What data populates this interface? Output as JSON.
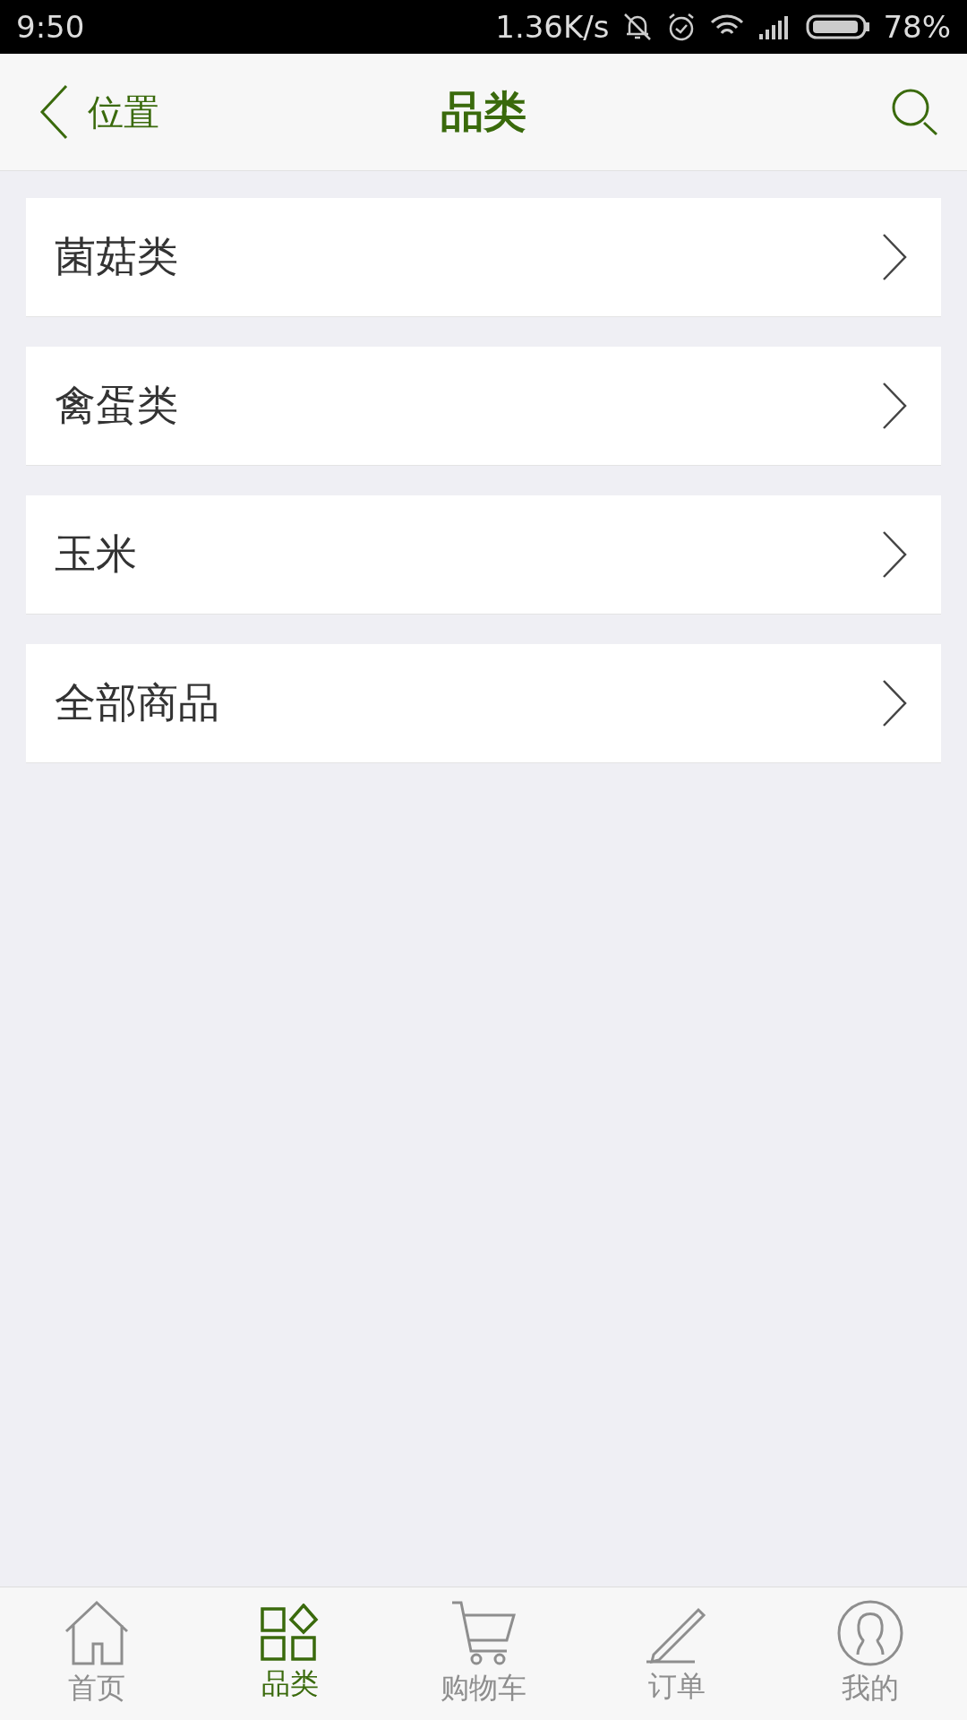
{
  "status_bar": {
    "time": "9:50",
    "speed": "1.36K/s",
    "battery": "78%"
  },
  "header": {
    "back_label": "位置",
    "title": "品类"
  },
  "categories": [
    {
      "label": "菌菇类"
    },
    {
      "label": "禽蛋类"
    },
    {
      "label": "玉米"
    },
    {
      "label": "全部商品"
    }
  ],
  "tabs": [
    {
      "label": "首页",
      "kind": "home",
      "selected": false
    },
    {
      "label": "品类",
      "kind": "grid",
      "selected": true
    },
    {
      "label": "购物车",
      "kind": "cart",
      "selected": false
    },
    {
      "label": "订单",
      "kind": "pencil",
      "selected": false
    },
    {
      "label": "我的",
      "kind": "user",
      "selected": false
    }
  ]
}
